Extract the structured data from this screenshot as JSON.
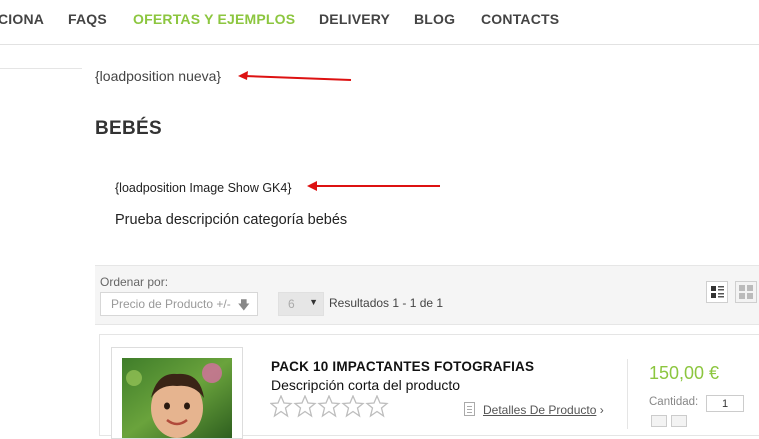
{
  "nav": {
    "items": [
      {
        "label": "CIONA",
        "active": false
      },
      {
        "label": "FAQS",
        "active": false
      },
      {
        "label": "OFERTAS Y EJEMPLOS",
        "active": true
      },
      {
        "label": "DELIVERY",
        "active": false
      },
      {
        "label": "BLOG",
        "active": false
      },
      {
        "label": "CONTACTS",
        "active": false
      }
    ],
    "active_color": "#8cc63f"
  },
  "content": {
    "loadposition_top": "{loadposition nueva}",
    "category_title": "BEBÉS",
    "loadposition_mid": "{loadposition Image Show GK4}",
    "category_description": "Prueba descripción categoría bebés"
  },
  "annotation": {
    "arrow_color": "#dd1111"
  },
  "sortbar": {
    "order_label": "Ordenar por:",
    "order_value": "Precio de Producto +/-",
    "order_icon": "sort-down-icon",
    "per_page": "6",
    "results": "Resultados 1 - 1 de 1",
    "views": [
      "list-view-icon",
      "grid-view-icon"
    ]
  },
  "product": {
    "title": "PACK 10 IMPACTANTES FOTOGRAFIAS",
    "short_description": "Descripción corta del producto",
    "rating_stars": 0,
    "rating_max": 5,
    "details_label": "Detalles De Producto",
    "details_arrow": "›",
    "price": "150,00 €",
    "price_color": "#8cc63f",
    "quantity_label": "Cantidad:",
    "quantity": "1"
  }
}
